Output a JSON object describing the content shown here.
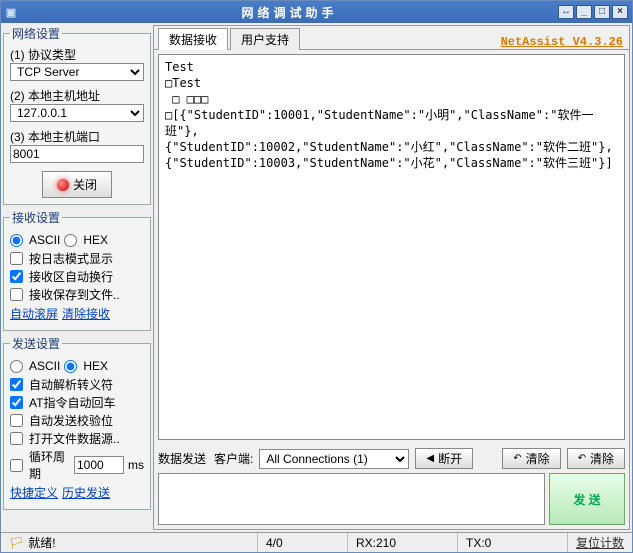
{
  "window": {
    "title": "网络调试助手"
  },
  "brand": "NetAssist V4.3.26",
  "tabs": {
    "recv": "数据接收",
    "user": "用户支持"
  },
  "net": {
    "legend": "网络设置",
    "proto_label": "(1) 协议类型",
    "proto_value": "TCP Server",
    "host_label": "(2) 本地主机地址",
    "host_value": "127.0.0.1",
    "port_label": "(3) 本地主机端口",
    "port_value": "8001",
    "close_btn": "关闭"
  },
  "recv": {
    "legend": "接收设置",
    "ascii": "ASCII",
    "hex": "HEX",
    "c1": "按日志模式显示",
    "c2": "接收区自动换行",
    "c3": "接收保存到文件..",
    "link1": "自动滚屏",
    "link2": "清除接收"
  },
  "send": {
    "legend": "发送设置",
    "ascii": "ASCII",
    "hex": "HEX",
    "c1": "自动解析转义符",
    "c2": "AT指令自动回车",
    "c3": "自动发送校验位",
    "c4": "打开文件数据源..",
    "cycle": "循环周期",
    "cycle_val": "1000",
    "ms": "ms",
    "link1": "快捷定义",
    "link2": "历史发送"
  },
  "recv_area": "Test\n□Test\n □ □□□\n□[{\"StudentID\":10001,\"StudentName\":\"小明\",\"ClassName\":\"软件一班\"},\n{\"StudentID\":10002,\"StudentName\":\"小红\",\"ClassName\":\"软件二班\"},\n{\"StudentID\":10003,\"StudentName\":\"小花\",\"ClassName\":\"软件三班\"}]",
  "sendbar": {
    "lbl": "数据发送",
    "client": "客户端:",
    "sel": "All Connections (1)",
    "disconnect": "断开",
    "clear1": "清除",
    "clear2": "清除",
    "send_btn": "发 送"
  },
  "status": {
    "ready": "就绪!",
    "c1": "4/0",
    "c2": "RX:210",
    "c3": "TX:0",
    "reset": "复位计数"
  }
}
